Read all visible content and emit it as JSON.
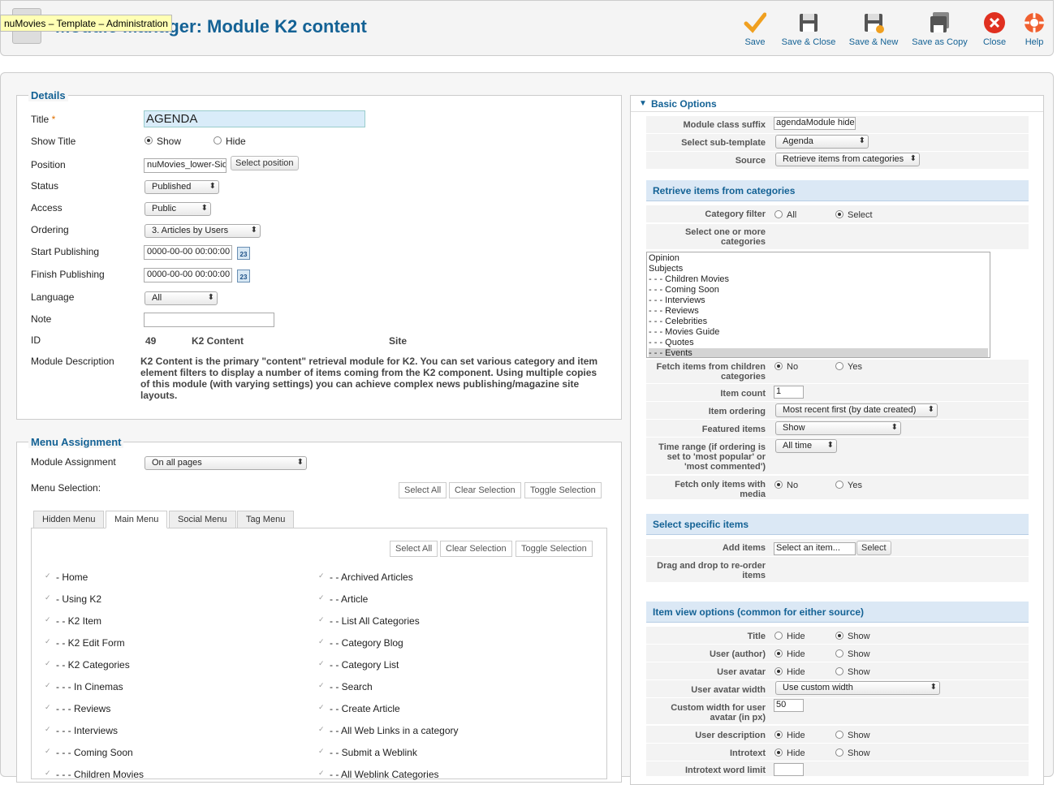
{
  "tooltip": "nuMovies – Template – Administration",
  "page_title": "Module Manager: Module K2 content",
  "toolbar": {
    "save": "Save",
    "save_close": "Save & Close",
    "save_new": "Save & New",
    "save_copy": "Save as Copy",
    "close": "Close",
    "help": "Help"
  },
  "details": {
    "legend": "Details",
    "title_label": "Title",
    "title_required": "*",
    "title_value": "AGENDA",
    "show_title_label": "Show Title",
    "show": "Show",
    "hide": "Hide",
    "position_label": "Position",
    "position_value": "nuMovies_lower-Sidebar",
    "select_position": "Select position",
    "status_label": "Status",
    "status_value": "Published",
    "access_label": "Access",
    "access_value": "Public",
    "ordering_label": "Ordering",
    "ordering_value": "3. Articles by Users",
    "start_label": "Start Publishing",
    "start_value": "0000-00-00 00:00:00",
    "finish_label": "Finish Publishing",
    "finish_value": "0000-00-00 00:00:00",
    "cal_day": "23",
    "language_label": "Language",
    "language_value": "All",
    "note_label": "Note",
    "note_value": "",
    "id_label": "ID",
    "id_value": "49",
    "id_type": "K2 Content",
    "id_site": "Site",
    "desc_label": "Module Description",
    "desc_text": "K2 Content is the primary \"content\" retrieval module for K2. You can set various category and item element filters to display a number of items coming from the K2 component. Using multiple copies of this module (with varying settings) you can achieve complex news publishing/magazine site layouts."
  },
  "menu": {
    "legend": "Menu Assignment",
    "module_assignment_label": "Module Assignment",
    "module_assignment_value": "On all pages",
    "menu_selection_label": "Menu Selection:",
    "select_all": "Select All",
    "clear_selection": "Clear Selection",
    "toggle_selection": "Toggle Selection",
    "tabs": [
      "Hidden Menu",
      "Main Menu",
      "Social Menu",
      "Tag Menu"
    ],
    "left_items": [
      "- Home",
      "- Using K2",
      "- - K2 Item",
      "- - K2 Edit Form",
      "- - K2 Categories",
      "- - - In Cinemas",
      "- - - Reviews",
      "- - - Interviews",
      "- - - Coming Soon",
      "- - - Children Movies"
    ],
    "right_items": [
      "- - Archived Articles",
      "- - Article",
      "- - List All Categories",
      "- - Category Blog",
      "- - Category List",
      "- - Search",
      "- - Create Article",
      "- - All Web Links in a category",
      "- - Submit a Weblink",
      "- - All Weblink Categories"
    ],
    "check": "✓"
  },
  "basic": {
    "legend": "Basic Options",
    "suffix_label": "Module class suffix",
    "suffix_value": "agendaModule hide",
    "subtemplate_label": "Select sub-template",
    "subtemplate_value": "Agenda",
    "source_label": "Source",
    "source_value": "Retrieve items from categories",
    "retrieve_header": "Retrieve items from categories",
    "category_filter_label": "Category filter",
    "all": "All",
    "select": "Select",
    "select_cats_label": "Select one or more categories",
    "categories": [
      "Opinion",
      "Subjects",
      "- - - Children Movies",
      "- - - Coming Soon",
      "- - - Interviews",
      "- - - Reviews",
      "- - - Celebrities",
      "- - - Movies Guide",
      "- - - Quotes",
      "- - - Events"
    ],
    "fetch_children_label": "Fetch items from children categories",
    "no": "No",
    "yes": "Yes",
    "item_count_label": "Item count",
    "item_count_value": "1",
    "item_ordering_label": "Item ordering",
    "item_ordering_value": "Most recent first (by date created)",
    "featured_label": "Featured items",
    "featured_value": "Show",
    "time_range_label": "Time range (if ordering is set to 'most popular' or 'most commented')",
    "time_range_value": "All time",
    "fetch_media_label": "Fetch only items with media",
    "specific_header": "Select specific items",
    "add_items_label": "Add items",
    "add_items_placeholder": "Select an item...",
    "select_btn": "Select",
    "drag_label": "Drag and drop to re-order items",
    "view_header": "Item view options (common for either source)",
    "title_label": "Title",
    "hide": "Hide",
    "show": "Show",
    "user_author_label": "User (author)",
    "user_avatar_label": "User avatar",
    "avatar_width_label": "User avatar width",
    "avatar_width_value": "Use custom width",
    "custom_width_label": "Custom width for user avatar (in px)",
    "custom_width_value": "50",
    "user_desc_label": "User description",
    "introtext_label": "Introtext",
    "introtext_limit_label": "Introtext word limit"
  }
}
